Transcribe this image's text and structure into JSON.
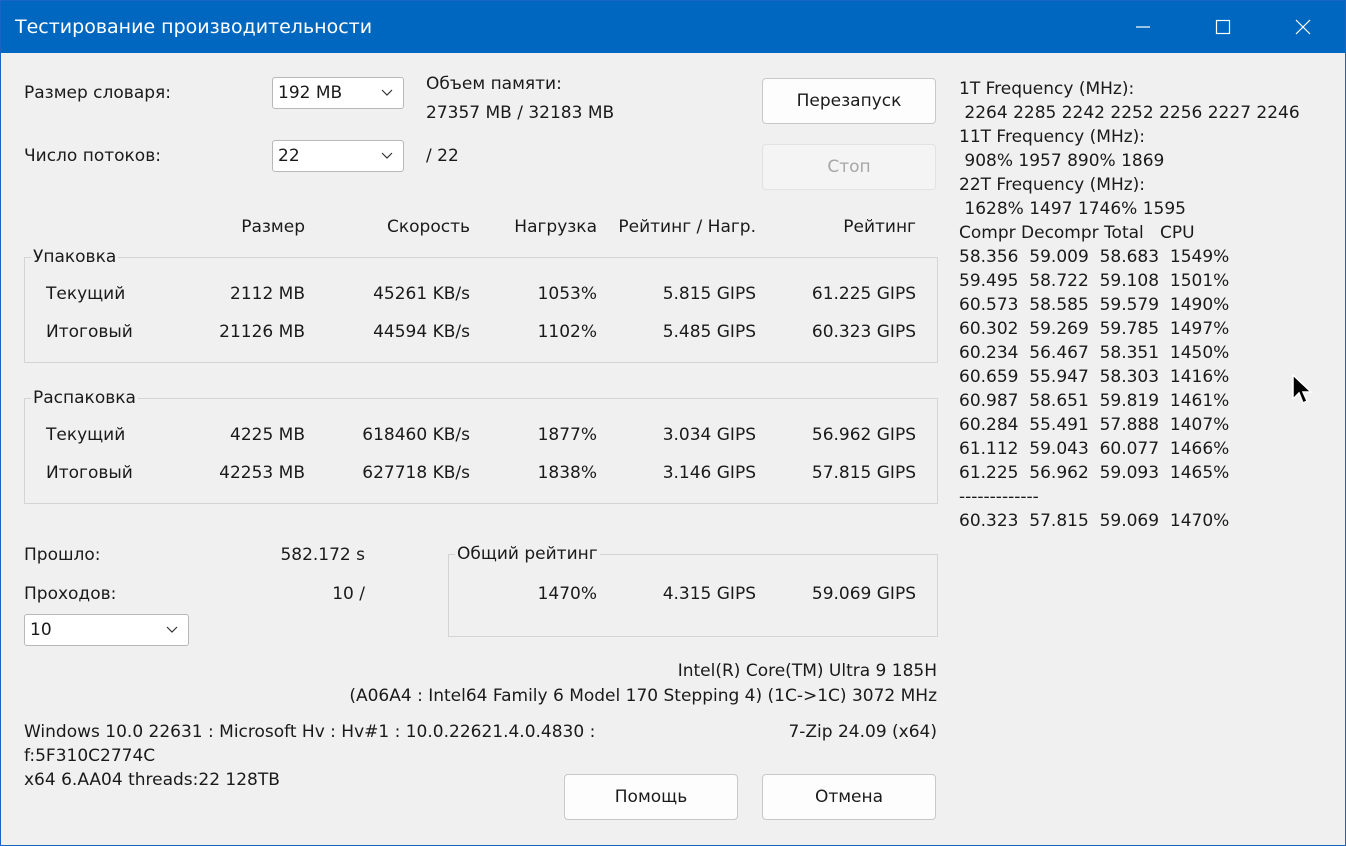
{
  "window": {
    "title": "Тестирование производительности"
  },
  "settings": {
    "dict_size_label": "Размер словаря:",
    "dict_size_value": "192 MB",
    "threads_label": "Число потоков:",
    "threads_value": "22",
    "threads_total": "/ 22",
    "memory_label": "Объем памяти:",
    "memory_value": "27357 MB / 32183 MB"
  },
  "buttons": {
    "restart": "Перезапуск",
    "stop": "Стоп",
    "help": "Помощь",
    "cancel": "Отмена"
  },
  "columns": {
    "size": "Размер",
    "speed": "Скорость",
    "load": "Нагрузка",
    "rating_per_load": "Рейтинг / Нагр.",
    "rating": "Рейтинг"
  },
  "pack": {
    "title": "Упаковка",
    "rows": [
      {
        "label": "Текущий",
        "size": "2112 MB",
        "speed": "45261 KB/s",
        "load": "1053%",
        "rpl": "5.815 GIPS",
        "rating": "61.225 GIPS"
      },
      {
        "label": "Итоговый",
        "size": "21126 MB",
        "speed": "44594 KB/s",
        "load": "1102%",
        "rpl": "5.485 GIPS",
        "rating": "60.323 GIPS"
      }
    ]
  },
  "unpack": {
    "title": "Распаковка",
    "rows": [
      {
        "label": "Текущий",
        "size": "4225 MB",
        "speed": "618460 KB/s",
        "load": "1877%",
        "rpl": "3.034 GIPS",
        "rating": "56.962 GIPS"
      },
      {
        "label": "Итоговый",
        "size": "42253 MB",
        "speed": "627718 KB/s",
        "load": "1838%",
        "rpl": "3.146 GIPS",
        "rating": "57.815 GIPS"
      }
    ]
  },
  "stats": {
    "elapsed_label": "Прошло:",
    "elapsed_value": "582.172 s",
    "passes_label": "Проходов:",
    "passes_value": "10 /",
    "passes_combo": "10"
  },
  "overall": {
    "title": "Общий рейтинг",
    "load": "1470%",
    "rpl": "4.315 GIPS",
    "rating": "59.069 GIPS"
  },
  "cpu": {
    "line1": "Intel(R) Core(TM) Ultra 9 185H",
    "line2": "(A06A4 : Intel64 Family 6 Model 170 Stepping 4) (1C->1C) 3072 MHz"
  },
  "sysinfo": {
    "line1": "Windows 10.0 22631 : Microsoft Hv : Hv#1 : 10.0.22621.4.0.4830 :",
    "line2": "f:5F310C2774C",
    "line3": "x64 6.AA04 threads:22 128TB",
    "version": "7-Zip 24.09 (x64)"
  },
  "log": [
    "1T Frequency (MHz):",
    " 2264 2285 2242 2252 2256 2227 2246",
    "11T Frequency (MHz):",
    " 908% 1957 890% 1869",
    "22T Frequency (MHz):",
    " 1628% 1497 1746% 1595",
    "Compr Decompr Total   CPU",
    "58.356  59.009  58.683  1549%",
    "59.495  58.722  59.108  1501%",
    "60.573  58.585  59.579  1490%",
    "60.302  59.269  59.785  1497%",
    "60.234  56.467  58.351  1450%",
    "60.659  55.947  58.303  1416%",
    "60.987  58.651  59.819  1461%",
    "60.284  55.491  57.888  1407%",
    "61.112  59.043  60.077  1466%",
    "61.225  56.962  59.093  1465%",
    "-------------",
    "60.323  57.815  59.069  1470%"
  ]
}
